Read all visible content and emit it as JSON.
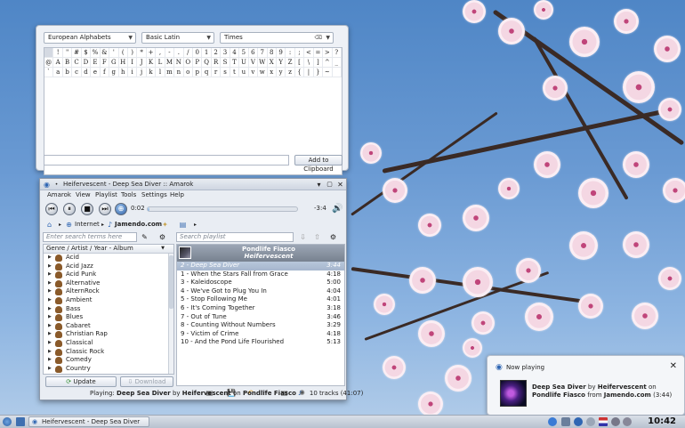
{
  "charselect": {
    "script_combo": "European Alphabets",
    "block_combo": "Basic Latin",
    "font_combo": "Times",
    "rows": [
      [
        "",
        "!",
        "\"",
        "#",
        "$",
        "%",
        "&",
        "'",
        "(",
        ")",
        "*",
        "+",
        ",",
        "-",
        ".",
        "/",
        "0",
        "1",
        "2",
        "3",
        "4",
        "5",
        "6",
        "7",
        "8",
        "9",
        ":",
        ";",
        "<",
        "=",
        ">",
        "?"
      ],
      [
        "@",
        "A",
        "B",
        "C",
        "D",
        "E",
        "F",
        "G",
        "H",
        "I",
        "J",
        "K",
        "L",
        "M",
        "N",
        "O",
        "P",
        "Q",
        "R",
        "S",
        "T",
        "U",
        "V",
        "W",
        "X",
        "Y",
        "Z",
        "[",
        "\\",
        "]",
        "^",
        "_"
      ],
      [
        "`",
        "a",
        "b",
        "c",
        "d",
        "e",
        "f",
        "g",
        "h",
        "i",
        "j",
        "k",
        "l",
        "m",
        "n",
        "o",
        "p",
        "q",
        "r",
        "s",
        "t",
        "u",
        "v",
        "w",
        "x",
        "y",
        "z",
        "{",
        "|",
        "}",
        "~",
        ""
      ]
    ],
    "add_button": "Add to Clipboard"
  },
  "amarok": {
    "window_title": "Heifervescent - Deep Sea Diver  ::  Amarok",
    "menu": [
      "Amarok",
      "View",
      "Playlist",
      "Tools",
      "Settings",
      "Help"
    ],
    "elapsed": "0:02",
    "remaining": "-3:4",
    "progress": 0.01,
    "breadcrumb_internet": "Internet",
    "breadcrumb_service": "Jamendo.com",
    "search_collection_placeholder": "Enter search terms here",
    "search_playlist_placeholder": "Search playlist",
    "tree_header": "Genre / Artist / Year - Album",
    "genres": [
      "Acid",
      "Acid Jazz",
      "Acid Punk",
      "Alternative",
      "AlternRock",
      "Ambient",
      "Bass",
      "Blues",
      "Cabaret",
      "Christian Rap",
      "Classical",
      "Classic Rock",
      "Comedy",
      "Country"
    ],
    "update_button": "Update",
    "download_button": "Download",
    "album_title": "Pondlife Fiasco",
    "album_artist": "Heifervescent",
    "tracks": [
      {
        "title": "2 - Deep Sea Diver",
        "length": "3:44",
        "current": true
      },
      {
        "title": "1 - When the Stars Fall from Grace",
        "length": "4:18",
        "current": false
      },
      {
        "title": "3 - Kaleidoscope",
        "length": "5:00",
        "current": false
      },
      {
        "title": "4 - We've Got to Plug You In",
        "length": "4:04",
        "current": false
      },
      {
        "title": "5 - Stop Following Me",
        "length": "4:01",
        "current": false
      },
      {
        "title": "6 - It's Coming Together",
        "length": "3:18",
        "current": false
      },
      {
        "title": "7 - Out of Tune",
        "length": "3:46",
        "current": false
      },
      {
        "title": "8 - Counting Without Numbers",
        "length": "3:29",
        "current": false
      },
      {
        "title": "9 - Victim of Crime",
        "length": "4:18",
        "current": false
      },
      {
        "title": "10 - And the Pond Life Flourished",
        "length": "5:13",
        "current": false
      }
    ],
    "status_playing": "Playing:",
    "status_track": "Deep Sea Diver",
    "status_by": "by",
    "status_artist": "Heifervescent",
    "status_on": "on",
    "status_album": "Pondlife Fiasco",
    "status_count": "10 tracks (41:07)"
  },
  "notification": {
    "title": "Now playing",
    "track": "Deep Sea Diver",
    "by": "by",
    "artist": "Heifervescent",
    "on": "on",
    "album": "Pondlife Fiasco",
    "from": "from",
    "source": "Jamendo.com",
    "duration": "(3:44)"
  },
  "taskbar": {
    "task_label": "Heifervescent - Deep Sea Diver",
    "clock": "10:42"
  },
  "colors": {
    "sky": "#5b8fcb",
    "accent": "#3a6db0",
    "current_track": "#a9b9cf"
  }
}
